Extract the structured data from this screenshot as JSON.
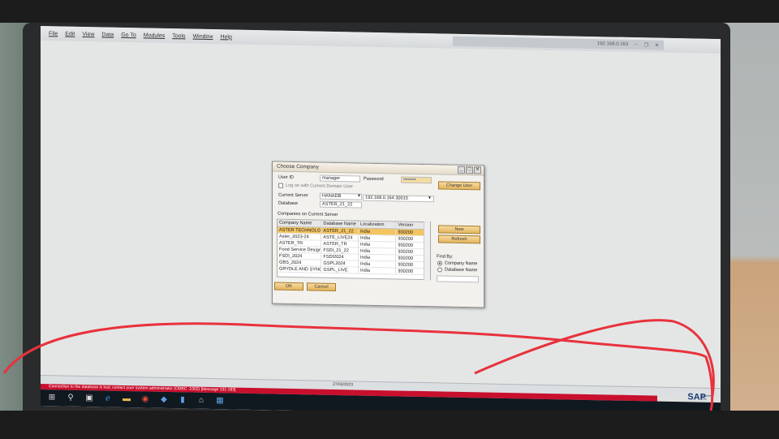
{
  "menu": [
    "File",
    "Edit",
    "View",
    "Data",
    "Go To",
    "Modules",
    "Tools",
    "Window",
    "Help"
  ],
  "server_address": "192.168.0.163",
  "dialog": {
    "title": "Choose Company",
    "user_id_label": "User ID",
    "user_id_value": "manager",
    "password_label": "Password",
    "password_value": "••••••••",
    "change_user_button": "Change User",
    "domain_user_label": "Log on with Current Domain User",
    "current_server_label": "Current Server",
    "server_type": "HANADB",
    "server_value": "192.168.0.164:30015",
    "database_label": "Database",
    "database_value": "ASTER_21_22",
    "companies_label": "Companies on Current Server",
    "columns": [
      "Company Name",
      "Database Name",
      "Localization",
      "Version"
    ],
    "rows": [
      [
        "ASTER TECHNOLOGIES",
        "ASTER_21_22",
        "India",
        "930200"
      ],
      [
        "Aster_2023-24",
        "ASTE_LIVE24",
        "India",
        "930200"
      ],
      [
        "ASTER_TR",
        "ASTER_TR",
        "India",
        "930200"
      ],
      [
        "Food Service Design I",
        "FSDI_21_22",
        "India",
        "930200"
      ],
      [
        "FSDI_2024",
        "FSDI2024",
        "India",
        "930200"
      ],
      [
        "GBS_2024",
        "GSPL2024",
        "India",
        "930200"
      ],
      [
        "GRYDLE AND SYNC P",
        "GSPL_LIVE",
        "India",
        "930200"
      ]
    ],
    "new_button": "New",
    "refresh_button": "Refresh",
    "find_by_label": "Find By:",
    "find_options": [
      "Company Name",
      "Database Name"
    ],
    "ok_button": "OK",
    "cancel_button": "Cancel"
  },
  "status": {
    "message": "Connection to the database is lost; contact your system administrator (ODBC -1002)  [Message 131-183]",
    "date": "27/03/2023"
  },
  "sap_logo": "SAP",
  "sap_logo_sub": "Business One",
  "colors": {
    "accent": "#e4b55d",
    "error": "#c8102e",
    "annotation": "#e8323c"
  },
  "taskbar_icons": [
    "windows-start-icon",
    "search-icon",
    "task-view-icon",
    "edge-icon",
    "file-explorer-icon",
    "chrome-icon",
    "app-icon",
    "app-icon-2",
    "network-icon",
    "sap-app-icon"
  ]
}
